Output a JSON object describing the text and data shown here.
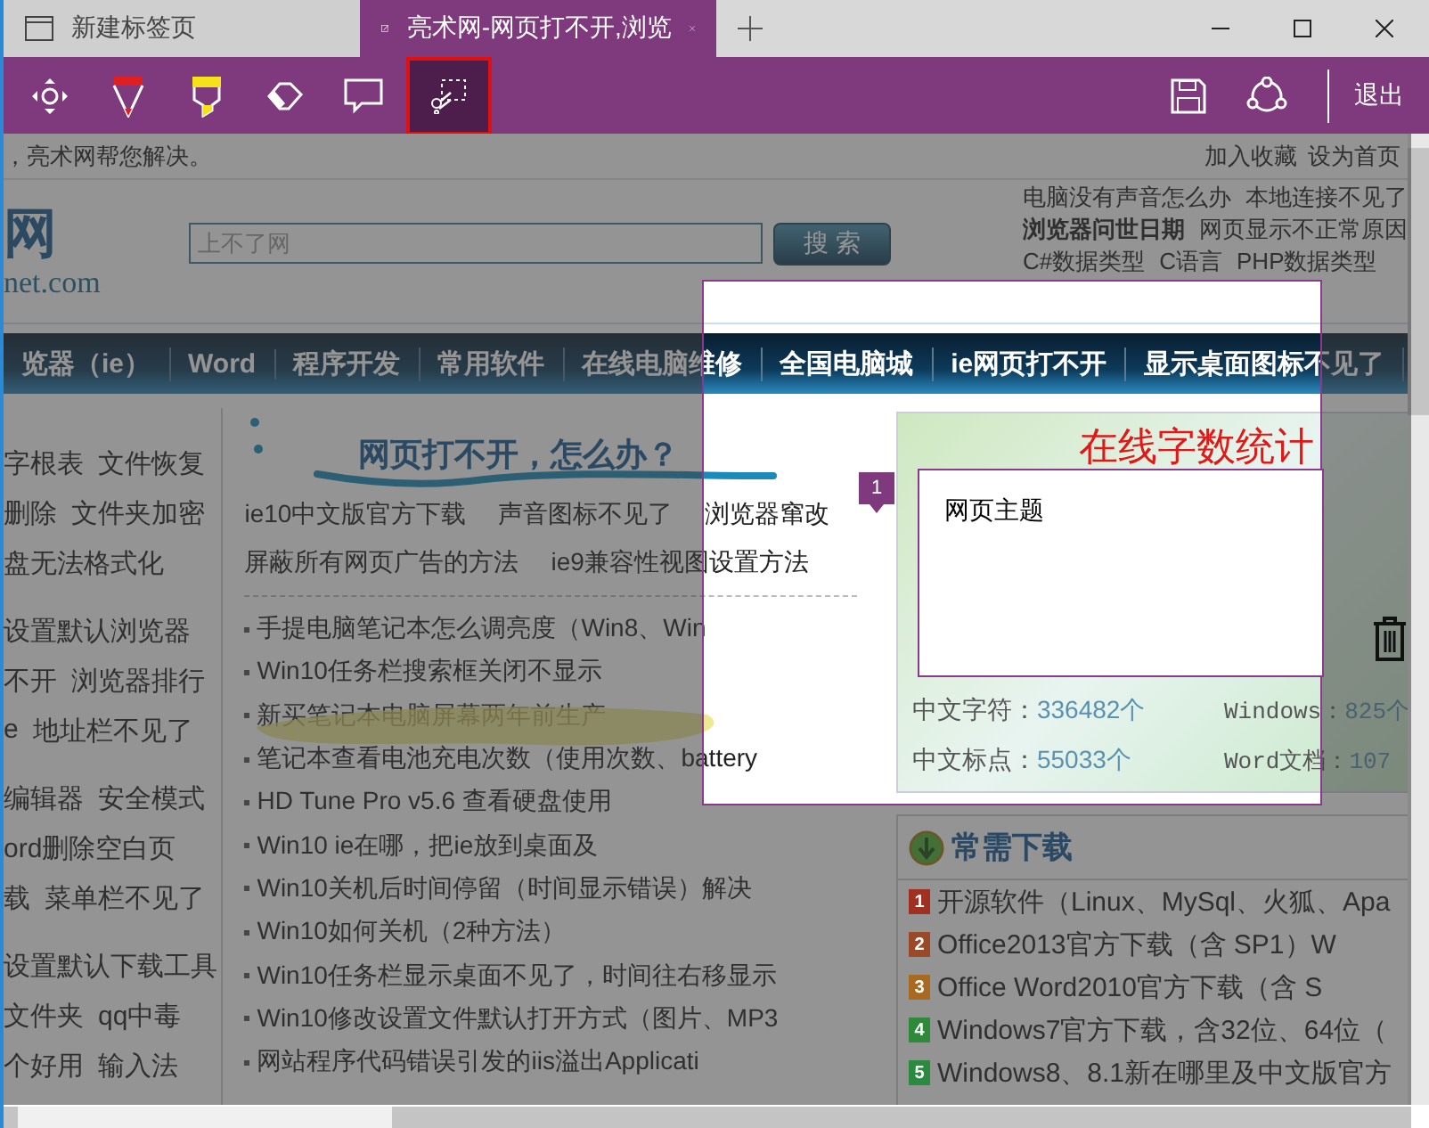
{
  "tabs": [
    {
      "label": "新建标签页",
      "selected": false,
      "kind": "page"
    },
    {
      "label": "亮术网-网页打不开,浏览",
      "selected": true,
      "kind": "note"
    }
  ],
  "toolbar": {
    "tools": [
      {
        "kind": "pan",
        "selected": false
      },
      {
        "kind": "pen",
        "selected": false
      },
      {
        "kind": "highlighter",
        "selected": false
      },
      {
        "kind": "eraser",
        "selected": false
      },
      {
        "kind": "comment",
        "selected": false
      },
      {
        "kind": "clip",
        "selected": true
      }
    ],
    "exit_label": "退出"
  },
  "page": {
    "tagline": "，亮术网帮您解决。",
    "top_links": [
      "加入收藏",
      "设为首页"
    ],
    "logo": {
      "mark": "网",
      "domain": "net.com"
    },
    "search": {
      "placeholder": "上不了网",
      "button": "搜 索"
    },
    "hot_links": [
      [
        {
          "text": "电脑没有声音怎么办",
          "bold": false
        },
        {
          "text": "本地连接不见了",
          "bold": false
        }
      ],
      [
        {
          "text": "浏览器问世日期",
          "bold": true
        },
        {
          "text": "网页显示不正常原因",
          "bold": false
        }
      ],
      [
        {
          "text": "C#数据类型",
          "bold": false
        },
        {
          "text": "C语言",
          "bold": false
        },
        {
          "text": "PHP数据类型",
          "bold": false
        }
      ]
    ],
    "nav": [
      "览器（ie）",
      "Word",
      "程序开发",
      "常用软件",
      "在线电脑维修",
      "全国电脑城",
      "ie网页打不开",
      "显示桌面图标不见了"
    ],
    "side_groups": [
      [
        [
          "字根表",
          "文件恢复"
        ],
        [
          "删除",
          "文件夹加密"
        ],
        [
          "盘无法格式化"
        ]
      ],
      [
        [
          "设置默认浏览器"
        ],
        [
          "不开",
          "浏览器排行"
        ],
        [
          "e",
          "地址栏不见了"
        ]
      ],
      [
        [
          "编辑器",
          "安全模式"
        ],
        [
          "ord删除空白页"
        ],
        [
          "载",
          "菜单栏不见了"
        ]
      ],
      [
        [
          "设置默认下载工具"
        ],
        [
          "文件夹",
          "qq中毒"
        ],
        [
          "个好用",
          "输入法"
        ]
      ]
    ],
    "feature": {
      "title": "网页打不开，怎么办？",
      "links": [
        [
          "ie10中文版官方下载",
          "声音图标不见了",
          "浏览器窜改"
        ],
        [
          "屏蔽所有网页广告的方法",
          "ie9兼容性视图设置方法"
        ]
      ]
    },
    "articles": [
      "手提电脑笔记本怎么调亮度（Win8、Win",
      "Win10任务栏搜索框关闭不显示",
      "新买笔记本电脑屏幕两年前生产",
      "笔记本查看电池充电次数（使用次数、battery",
      "HD Tune Pro v5.6 查看硬盘使用",
      "Win10 ie在哪，把ie放到桌面及",
      "Win10关机后时间停留（时间显示错误）解决",
      "Win10如何关机（2种方法）",
      "Win10任务栏显示桌面不见了，时间往右移显示",
      "Win10修改设置文件默认打开方式（图片、MP3",
      "网站程序代码错误引发的iis溢出Applicati"
    ],
    "counter": {
      "title": "在线字数统计",
      "stats": [
        {
          "label": "中文字符：",
          "value": "336482个"
        },
        {
          "label": "Windows：",
          "value": "825个"
        },
        {
          "label": "中文标点：",
          "value": "55033个"
        },
        {
          "label": "Word文档：",
          "value": "107"
        }
      ]
    },
    "downloads": {
      "title": "常需下载",
      "items": [
        {
          "number": "1",
          "color": "#a03020",
          "text": "开源软件（Linux、MySql、火狐、Apa"
        },
        {
          "number": "2",
          "color": "#9a4a28",
          "text": "Office2013官方下载（含 SP1）W"
        },
        {
          "number": "3",
          "color": "#a86a20",
          "text": "Office Word2010官方下载（含 S"
        },
        {
          "number": "4",
          "color": "#2e8a3a",
          "text": "Windows7官方下载，含32位、64位（"
        },
        {
          "number": "5",
          "color": "#2a8a40",
          "text": "Windows8、8.1新在哪里及中文版官方"
        }
      ]
    },
    "note": {
      "badge": "1",
      "text": "网页主题"
    }
  }
}
